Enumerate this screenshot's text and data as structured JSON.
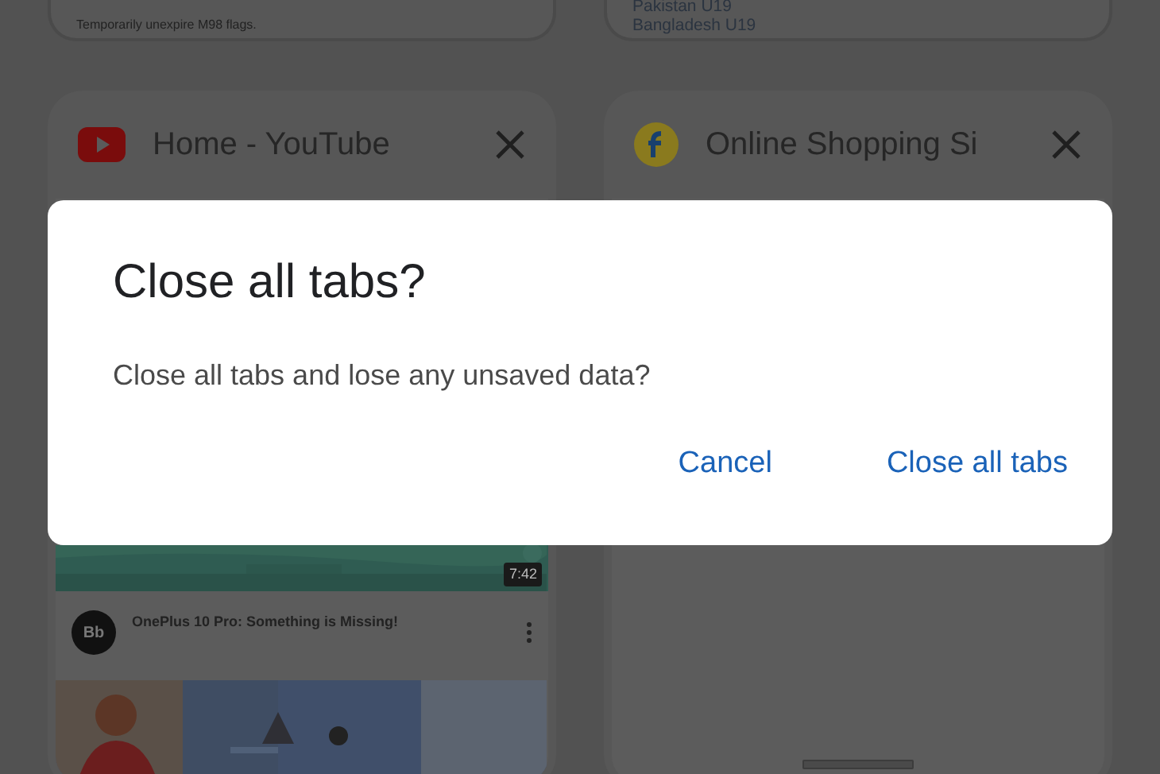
{
  "top_cards": [
    {
      "lines": [
        "Temporarily unexpire M98 flags."
      ]
    },
    {
      "lines": [
        "Pakistan U19",
        "Bangladesh U19"
      ]
    }
  ],
  "tabs": [
    {
      "title": "Home - YouTube",
      "kind": "video"
    },
    {
      "title": "Online Shopping Si",
      "kind": "shop"
    }
  ],
  "video": {
    "duration": "7:42",
    "avatar": "Bb",
    "title": "OnePlus 10 Pro: Something is Missing!"
  },
  "dialog": {
    "title": "Close all tabs?",
    "message": "Close all tabs and lose any unsaved data?",
    "buttons": [
      "Cancel",
      "Close all tabs"
    ]
  }
}
